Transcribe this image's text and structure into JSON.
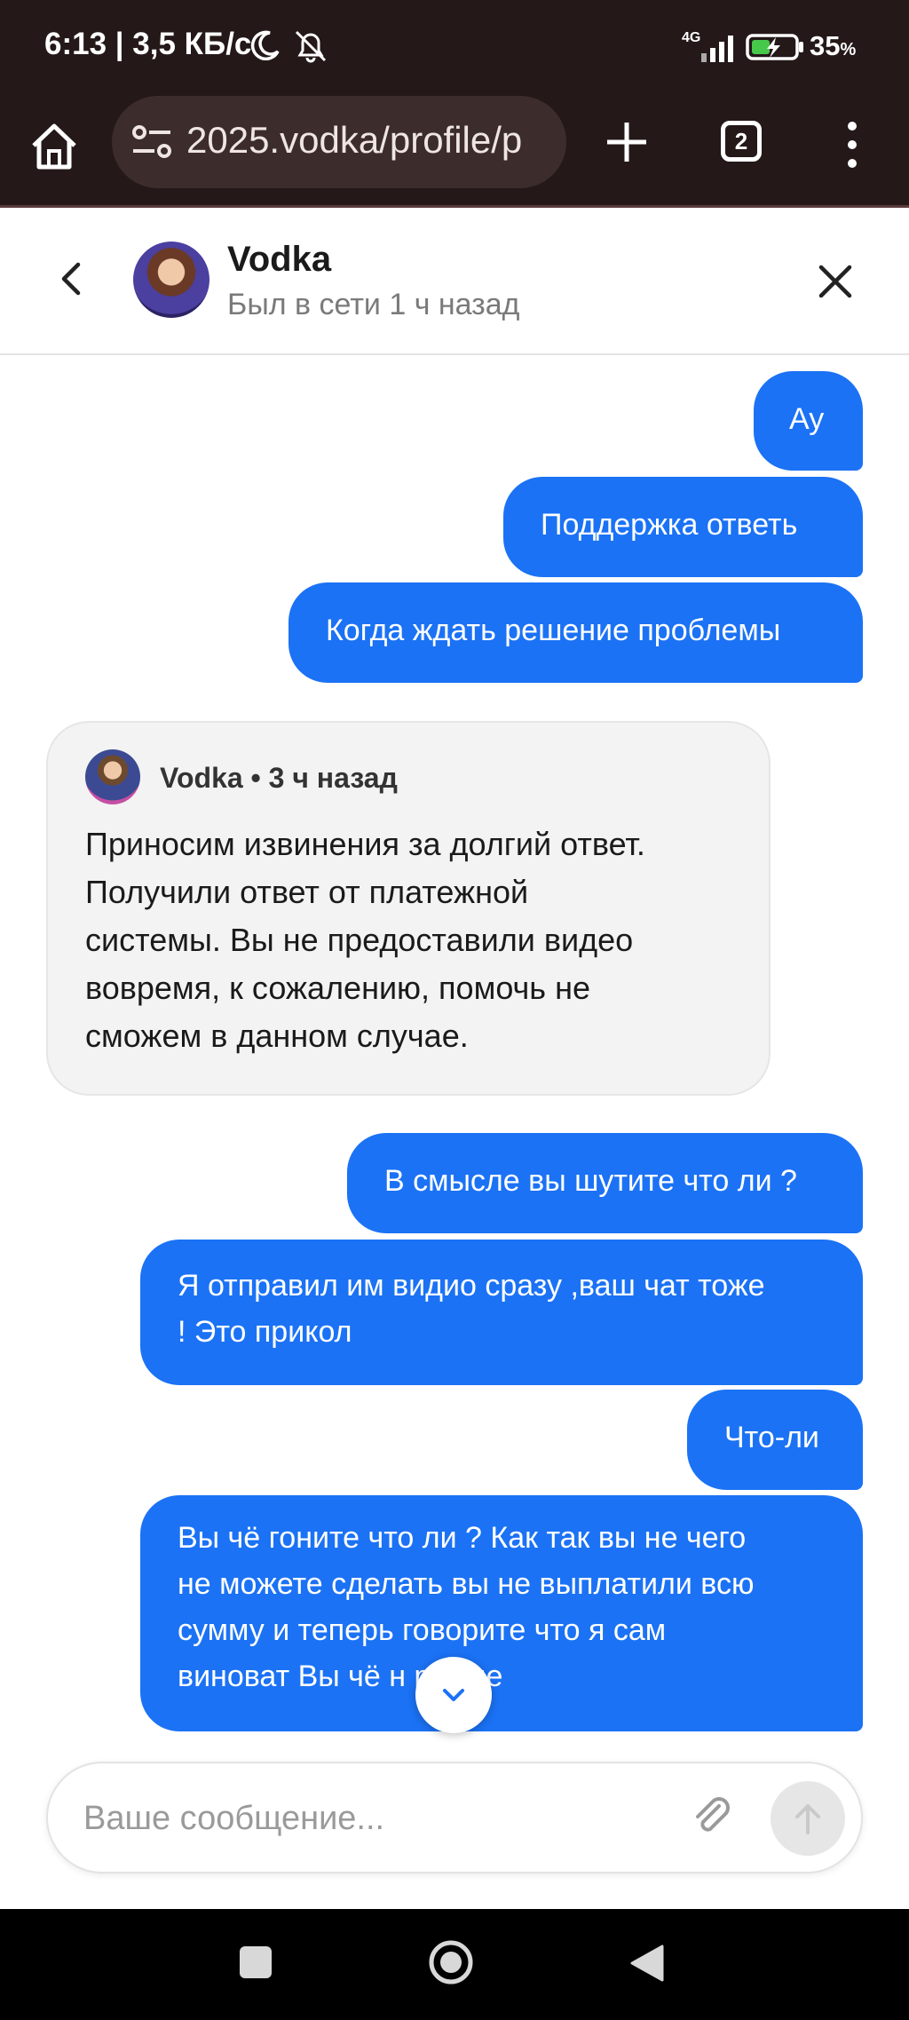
{
  "status_bar": {
    "time": "6:13 | 3,5 КБ/с",
    "network": "4G",
    "battery": "35",
    "battery_unit": "%"
  },
  "browser": {
    "url": "2025.vodka/profile/p",
    "tab_count": "2"
  },
  "chat_header": {
    "name": "Vodka",
    "status": "Был в сети 1 ч назад"
  },
  "messages": {
    "out_1": "Ау",
    "out_2": "Поддержка ответь",
    "out_3": "Когда ждать решение проблемы",
    "in_1": {
      "meta": "Vodka • 3 ч назад",
      "lines": [
        "Приносим извинения за долгий ответ.",
        "Получили ответ от платежной",
        "системы. Вы не предоставили видео",
        "вовремя, к сожалению, помочь не",
        "сможем в данном случае."
      ]
    },
    "out_4": "В смысле вы шутите что ли ?",
    "out_5": {
      "lines": [
        "Я отправил им видио сразу ,ваш чат тоже",
        "! Это прикол"
      ]
    },
    "out_6": "Что-ли",
    "out_7": {
      "lines": [
        "Вы чё гоните что ли ? Как так вы не чего",
        "не можете сделать вы не выплатили всю",
        "сумму и теперь говорите что я сам",
        "виноват Вы чё н   реные"
      ]
    }
  },
  "composer": {
    "placeholder": "Ваше сообщение..."
  },
  "colors": {
    "accent": "#1b72f5",
    "browser_bg": "#241818",
    "incoming_bg": "#f3f3f3"
  }
}
